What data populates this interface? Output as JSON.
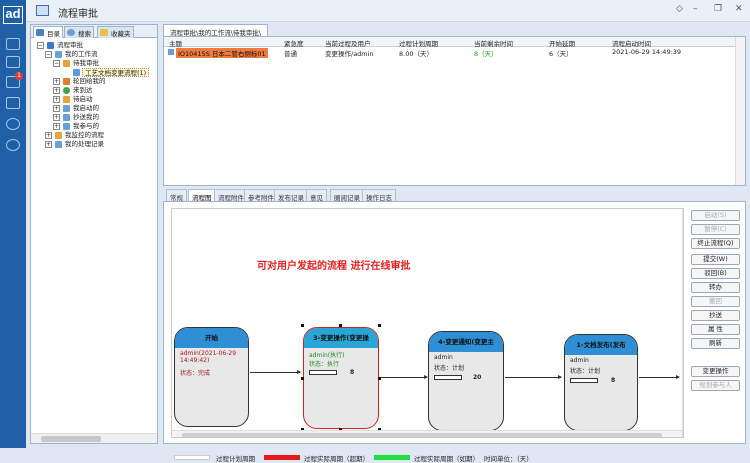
{
  "app": {
    "logo_text": "ad",
    "title": "流程审批",
    "badge_count": "1"
  },
  "left_tabs": [
    {
      "label": "目录"
    },
    {
      "label": "搜索"
    },
    {
      "label": "收藏夹"
    }
  ],
  "tree": {
    "root": "流程审批",
    "my_workflow": "我的工作流",
    "pending": "待我审批",
    "pending_item": "工艺文档变更流程(1)",
    "items": [
      "轮回给我的",
      "来到达",
      "待启动",
      "我启动的",
      "抄送我的",
      "我参与的"
    ],
    "monitored": "我监控的流程",
    "records": "我的处理记录"
  },
  "top_tab": "流程审批\\我的工作流\\待我审批\\",
  "list": {
    "headers": [
      "主题",
      "紧急度",
      "当前过程及用户",
      "过程计划周期",
      "当前剩余时间",
      "开始延期",
      "流程启动时间"
    ],
    "row": {
      "subject": "IO10415S 日本二管右侧标01",
      "urgency": "普通",
      "current": "变更操作/admin",
      "plan": "8.00（天）",
      "remain": "8（天）",
      "delay": "6（天）",
      "start": "2021-06-29 14:49:39"
    }
  },
  "bottom_tabs": [
    "常规",
    "流程图",
    "流程附件",
    "参考附件",
    "发布记录",
    "意见",
    "圈阅记录",
    "操作日志"
  ],
  "flow": {
    "headline": "可对用户发起的流程  进行在线审批",
    "nodes": [
      {
        "title": "开始",
        "user": "admin(2021-06-29 14:49:42)",
        "state": "状态：完成",
        "num": ""
      },
      {
        "title": "3-变更操作(变更操",
        "user": "admin(执行)",
        "state": "状态：执行",
        "num": "8"
      },
      {
        "title": "4-变更通知(变更主",
        "user": "admin",
        "state": "状态：计划",
        "num": "20"
      },
      {
        "title": "1-文档发布(发布",
        "user": "admin",
        "state": "状态：计划",
        "num": "8"
      }
    ]
  },
  "buttons": [
    {
      "label": "启动(S)",
      "enabled": false
    },
    {
      "label": "暂停(C)",
      "enabled": false
    },
    {
      "label": "终止流程(Q)",
      "enabled": true
    },
    {
      "label": "提交(W)",
      "enabled": true
    },
    {
      "label": "驳回(B)",
      "enabled": true
    },
    {
      "label": "转办",
      "enabled": true
    },
    {
      "label": "撤回",
      "enabled": false
    },
    {
      "label": "抄送",
      "enabled": true
    },
    {
      "label": "属    性",
      "enabled": true
    },
    {
      "label": "刷新",
      "enabled": true
    },
    {
      "label": "变更操作",
      "enabled": true
    },
    {
      "label": "规划参与人",
      "enabled": false
    }
  ],
  "legend": {
    "items": [
      {
        "label": "过程计划周期",
        "color": "#ffffff"
      },
      {
        "label": "过程实际周期（超期）",
        "color": "#e41a1a"
      },
      {
        "label": "过程实际周期（如期）",
        "color": "#22dd44"
      }
    ],
    "unit": "时间单位：（天）"
  },
  "colors": {
    "rail": "#1f5fa6",
    "node_header": "#2f8fd4",
    "subject_highlight": "#f07b3f"
  }
}
